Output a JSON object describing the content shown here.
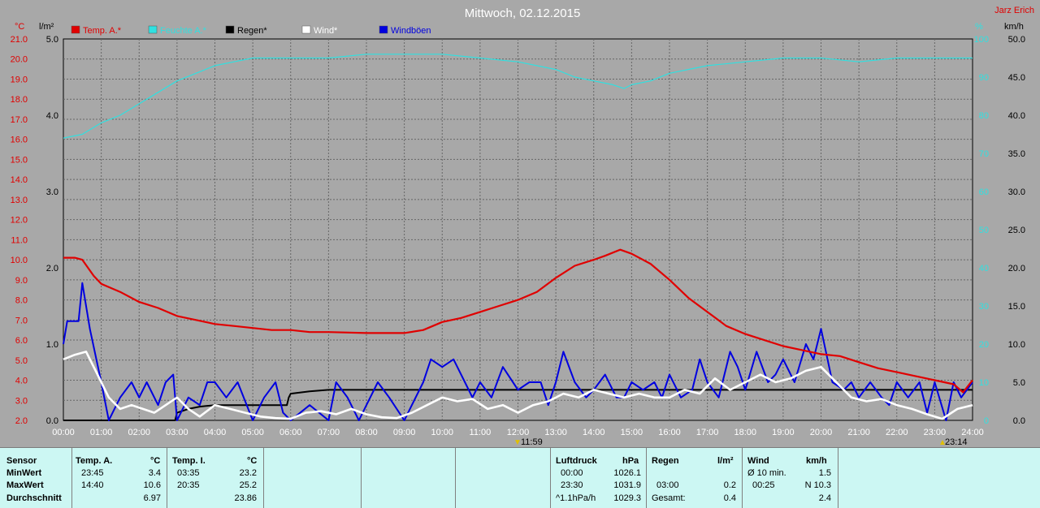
{
  "header": {
    "title": "Mittwoch, 02.12.2015",
    "author": "Jarz Erich"
  },
  "units": {
    "temp": "°C",
    "rain": "l/m²",
    "humidity": "%",
    "wind": "km/h"
  },
  "legend": [
    {
      "label": "Temp. A.*",
      "color": "#e00000"
    },
    {
      "label": "Feuchte A.*",
      "color": "#30e0e0"
    },
    {
      "label": "Regen*",
      "color": "#000000"
    },
    {
      "label": "Wind*",
      "color": "#ffffff"
    },
    {
      "label": "Windböen",
      "color": "#0000e0"
    }
  ],
  "markers": {
    "min_time": "11:59",
    "max_time": "23:14"
  },
  "chart_data": {
    "type": "line",
    "title": "Mittwoch, 02.12.2015",
    "x_range_hours": [
      0,
      24
    ],
    "x_ticks": [
      "00:00",
      "01:00",
      "02:00",
      "03:00",
      "04:00",
      "05:00",
      "06:00",
      "07:00",
      "08:00",
      "09:00",
      "10:00",
      "11:00",
      "12:00",
      "13:00",
      "14:00",
      "15:00",
      "16:00",
      "17:00",
      "18:00",
      "19:00",
      "20:00",
      "21:00",
      "22:00",
      "23:00",
      "24:00"
    ],
    "axes": {
      "temp": {
        "unit": "°C",
        "range": [
          2.0,
          21.0
        ],
        "ticks": [
          "21.0",
          "20.0",
          "19.0",
          "18.0",
          "17.0",
          "16.0",
          "15.0",
          "14.0",
          "13.0",
          "12.0",
          "11.0",
          "10.0",
          "9.0",
          "8.0",
          "7.0",
          "6.0",
          "5.0",
          "4.0",
          "3.0",
          "2.0"
        ]
      },
      "rain": {
        "unit": "l/m²",
        "range": [
          0.0,
          5.0
        ],
        "ticks": [
          "5.0",
          "4.0",
          "3.0",
          "2.0",
          "1.0",
          "0.0"
        ]
      },
      "humidity": {
        "unit": "%",
        "range": [
          0,
          100
        ],
        "ticks": [
          "100",
          "90",
          "80",
          "70",
          "60",
          "50",
          "40",
          "30",
          "20",
          "10",
          "0"
        ]
      },
      "wind": {
        "unit": "km/h",
        "range": [
          0.0,
          50.0
        ],
        "ticks": [
          "50.0",
          "45.0",
          "40.0",
          "35.0",
          "30.0",
          "25.0",
          "20.0",
          "15.0",
          "10.0",
          "5.0",
          "0.0"
        ]
      }
    },
    "grid": true,
    "series": [
      {
        "name": "Temp. A.*",
        "axis": "temp",
        "color": "#e00000",
        "x": [
          0,
          0.3,
          0.5,
          0.8,
          1.0,
          1.5,
          2.0,
          2.5,
          3.0,
          3.5,
          4.0,
          4.5,
          5.0,
          5.5,
          6.0,
          6.5,
          7.0,
          8.0,
          9.0,
          9.5,
          10.0,
          10.5,
          11.0,
          11.5,
          12.0,
          12.5,
          13.0,
          13.5,
          14.0,
          14.3,
          14.7,
          15.0,
          15.5,
          16.0,
          16.5,
          17.0,
          17.5,
          18.0,
          18.5,
          19.0,
          19.5,
          20.0,
          20.5,
          21.0,
          21.5,
          22.0,
          22.5,
          23.0,
          23.5,
          23.75,
          24.0
        ],
        "y": [
          10.1,
          10.1,
          10.0,
          9.2,
          8.8,
          8.4,
          7.9,
          7.6,
          7.2,
          7.0,
          6.8,
          6.7,
          6.6,
          6.5,
          6.5,
          6.4,
          6.4,
          6.35,
          6.35,
          6.5,
          6.9,
          7.1,
          7.4,
          7.7,
          8.0,
          8.4,
          9.1,
          9.7,
          10.0,
          10.2,
          10.5,
          10.3,
          9.8,
          9.0,
          8.1,
          7.4,
          6.7,
          6.3,
          6.0,
          5.7,
          5.5,
          5.3,
          5.2,
          4.9,
          4.6,
          4.4,
          4.2,
          4.0,
          3.8,
          3.4,
          4.0
        ]
      },
      {
        "name": "Feuchte A.*",
        "axis": "humidity",
        "color": "#30e0e0",
        "x": [
          0,
          0.5,
          1.0,
          1.5,
          2.0,
          2.5,
          3.0,
          3.5,
          4.0,
          4.5,
          5.0,
          6.0,
          7.0,
          8.0,
          9.0,
          10.0,
          11.0,
          12.0,
          13.0,
          13.5,
          14.0,
          14.5,
          14.8,
          15.0,
          15.5,
          16.0,
          17.0,
          18.0,
          19.0,
          20.0,
          21.0,
          22.0,
          23.0,
          23.5,
          24.0
        ],
        "y": [
          74,
          75,
          78,
          80,
          83,
          86,
          89,
          91,
          93,
          94,
          95,
          95,
          95,
          96,
          96,
          96,
          95,
          94,
          92,
          90,
          89,
          88,
          87,
          88,
          89,
          91,
          93,
          94,
          95,
          95,
          94,
          95,
          95,
          95,
          95
        ]
      },
      {
        "name": "Regen*",
        "axis": "rain",
        "color": "#000000",
        "x": [
          0,
          2.5,
          2.95,
          3.0,
          3.3,
          3.6,
          4.0,
          4.5,
          5.0,
          5.9,
          5.95,
          6.0,
          6.5,
          7.0,
          9.0,
          12.0,
          15.0,
          18.0,
          21.0,
          24.0
        ],
        "y": [
          0,
          0,
          0,
          0.1,
          0.15,
          0.18,
          0.2,
          0.2,
          0.2,
          0.2,
          0.3,
          0.35,
          0.38,
          0.4,
          0.4,
          0.4,
          0.4,
          0.4,
          0.4,
          0.4
        ]
      },
      {
        "name": "Wind*",
        "axis": "wind",
        "color": "#ffffff",
        "x": [
          0,
          0.3,
          0.6,
          0.9,
          1.2,
          1.5,
          1.8,
          2.1,
          2.4,
          2.7,
          3.0,
          3.3,
          3.6,
          4.0,
          4.4,
          4.8,
          5.2,
          5.6,
          6.0,
          6.4,
          6.8,
          7.2,
          7.6,
          8.0,
          8.4,
          8.8,
          9.2,
          9.6,
          10.0,
          10.4,
          10.8,
          11.2,
          11.6,
          12.0,
          12.4,
          12.8,
          13.2,
          13.6,
          14.0,
          14.4,
          14.8,
          15.2,
          15.6,
          16.0,
          16.4,
          16.8,
          17.2,
          17.6,
          18.0,
          18.4,
          18.8,
          19.2,
          19.6,
          20.0,
          20.4,
          20.8,
          21.2,
          21.6,
          22.0,
          22.4,
          22.8,
          23.2,
          23.6,
          24.0
        ],
        "y": [
          8.0,
          8.6,
          9.0,
          6.0,
          3.0,
          1.5,
          2.0,
          1.5,
          1.0,
          2.0,
          3.0,
          1.5,
          0.5,
          2.0,
          1.5,
          1.0,
          0.5,
          0.3,
          0.2,
          1.0,
          1.2,
          0.8,
          1.5,
          0.8,
          0.4,
          0.3,
          1.0,
          2.0,
          3.0,
          2.5,
          2.8,
          1.5,
          2.0,
          1.0,
          2.0,
          2.5,
          3.5,
          3.0,
          4.0,
          3.5,
          3.0,
          3.5,
          3.0,
          3.0,
          4.0,
          3.5,
          5.5,
          4.0,
          5.0,
          6.0,
          5.0,
          5.5,
          6.5,
          7.0,
          5.0,
          3.0,
          2.5,
          2.8,
          2.0,
          1.5,
          0.8,
          0.2,
          1.5,
          2.0
        ]
      },
      {
        "name": "Windböen",
        "axis": "wind",
        "color": "#0000e0",
        "x": [
          0,
          0.1,
          0.4,
          0.5,
          0.7,
          1.0,
          1.2,
          1.5,
          1.8,
          2.0,
          2.2,
          2.5,
          2.7,
          2.9,
          3.0,
          3.3,
          3.6,
          3.8,
          4.0,
          4.3,
          4.6,
          5.0,
          5.3,
          5.6,
          5.8,
          6.0,
          6.5,
          7.0,
          7.2,
          7.5,
          7.8,
          8.0,
          8.3,
          8.6,
          9.0,
          9.2,
          9.5,
          9.7,
          10.0,
          10.3,
          10.6,
          10.8,
          11.0,
          11.3,
          11.6,
          12.0,
          12.3,
          12.6,
          12.8,
          13.0,
          13.2,
          13.5,
          13.8,
          14.0,
          14.3,
          14.6,
          14.8,
          15.0,
          15.3,
          15.6,
          15.8,
          16.0,
          16.3,
          16.6,
          16.8,
          17.0,
          17.3,
          17.6,
          17.8,
          18.0,
          18.3,
          18.6,
          18.8,
          19.0,
          19.3,
          19.6,
          19.8,
          20.0,
          20.3,
          20.6,
          20.8,
          21.0,
          21.3,
          21.6,
          21.8,
          22.0,
          22.3,
          22.6,
          22.8,
          23.0,
          23.3,
          23.5,
          23.7,
          24.0
        ],
        "y": [
          10,
          13,
          13,
          18,
          12,
          5,
          0,
          3,
          5,
          3,
          5,
          2,
          5,
          6,
          0,
          3,
          2,
          5,
          5,
          3,
          5,
          0,
          3,
          5,
          1,
          0,
          2,
          0,
          5,
          3,
          0,
          2,
          5,
          3,
          0,
          2,
          5,
          8,
          7,
          8,
          5,
          3,
          5,
          3,
          7,
          4,
          5,
          5,
          2,
          5,
          9,
          5,
          3,
          4,
          6,
          3,
          3,
          5,
          4,
          5,
          3,
          6,
          3,
          4,
          8,
          5,
          3,
          9,
          7,
          4,
          9,
          5,
          6,
          8,
          5,
          10,
          8,
          12,
          5,
          4,
          5,
          3,
          5,
          3,
          2,
          5,
          3,
          5,
          1,
          5,
          0,
          5,
          3,
          5
        ]
      }
    ]
  },
  "panel": {
    "sensor_col": {
      "header": "Sensor",
      "rows": [
        "MinWert",
        "MaxWert",
        "Durchschnitt"
      ]
    },
    "temp_a": {
      "header": "Temp. A.",
      "unit": "°C",
      "rows": [
        {
          "time": "23:45",
          "value": "3.4"
        },
        {
          "time": "14:40",
          "value": "10.6"
        },
        {
          "time": "",
          "value": "6.97"
        }
      ]
    },
    "temp_i": {
      "header": "Temp. I.",
      "unit": "°C",
      "rows": [
        {
          "time": "03:35",
          "value": "23.2"
        },
        {
          "time": "20:35",
          "value": "25.2"
        },
        {
          "time": "",
          "value": "23.86"
        }
      ]
    },
    "pressure": {
      "header": "Luftdruck",
      "unit": "hPa",
      "rows": [
        {
          "time": "00:00",
          "value": "1026.1"
        },
        {
          "time": "23:30",
          "value": "1031.9"
        },
        {
          "time": "^1.1hPa/h",
          "value": "1029.3"
        }
      ]
    },
    "rain": {
      "header": "Regen",
      "unit": "l/m²",
      "rows": [
        {
          "time": "",
          "value": ""
        },
        {
          "time": "03:00",
          "value": "0.2"
        },
        {
          "time": "Gesamt:",
          "value": "0.4"
        }
      ]
    },
    "wind": {
      "header": "Wind",
      "unit": "km/h",
      "rows": [
        {
          "time": "Ø 10 min.",
          "value": "1.5"
        },
        {
          "time": "00:25",
          "value": "N 10.3"
        },
        {
          "time": "",
          "value": "2.4"
        }
      ]
    }
  }
}
